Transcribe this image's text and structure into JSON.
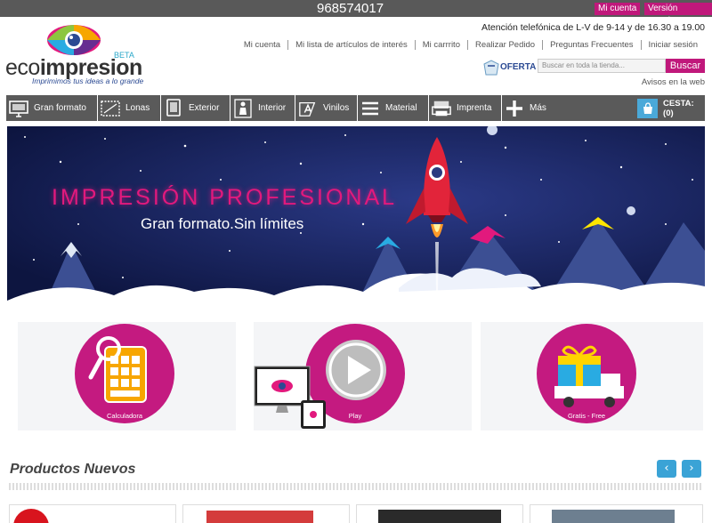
{
  "topbar": {
    "phone": "968574017",
    "mobile_label": "Mi cuenta",
    "previous_label": "Versión anterior"
  },
  "logo": {
    "word_light": "eco",
    "word_bold": "impresion",
    "beta": "BETA",
    "tagline": "Imprimimos tus ideas a lo grande"
  },
  "header": {
    "phone_info": "Atención telefónica de L-V de 9-14 y de 16.30 a 19.00",
    "links": [
      "Mi cuenta",
      "Mi lista de artículos de interés",
      "Mi carrrito",
      "Realizar Pedido",
      "Preguntas Frecuentes",
      "Iniciar sesión"
    ],
    "oferta_label": "OFERTA",
    "search_placeholder": "Buscar en toda la tienda...",
    "search_button": "Buscar",
    "avisos": "Avisos en la web"
  },
  "nav": {
    "items": [
      {
        "label": "Gran formato",
        "icon": "monitor-icon"
      },
      {
        "label": "Lonas",
        "icon": "banner-icon"
      },
      {
        "label": "Exterior",
        "icon": "panel-icon"
      },
      {
        "label": "Interior",
        "icon": "person-icon"
      },
      {
        "label": "Vinilos",
        "icon": "vinyl-icon"
      },
      {
        "label": "Material",
        "icon": "list-icon"
      },
      {
        "label": "Imprenta",
        "icon": "printer-icon"
      },
      {
        "label": "Más",
        "icon": "plus-icon"
      }
    ],
    "cart_label": "CESTA: (0)"
  },
  "hero": {
    "title": "IMPRESIÓN PROFESIONAL",
    "subtitle": "Gran formato.Sin límites"
  },
  "features": [
    {
      "label": "Calculadora",
      "icon": "calculator-icon"
    },
    {
      "label": "Play",
      "icon": "play-icon"
    },
    {
      "label": "Gratis - Free",
      "icon": "gift-truck-icon"
    }
  ],
  "products": {
    "title": "Productos Nuevos",
    "prev": "‹",
    "next": "›"
  },
  "colors": {
    "accent": "#c0187b",
    "nav_bg": "#5a5a5a",
    "blue": "#3aa3d6"
  }
}
